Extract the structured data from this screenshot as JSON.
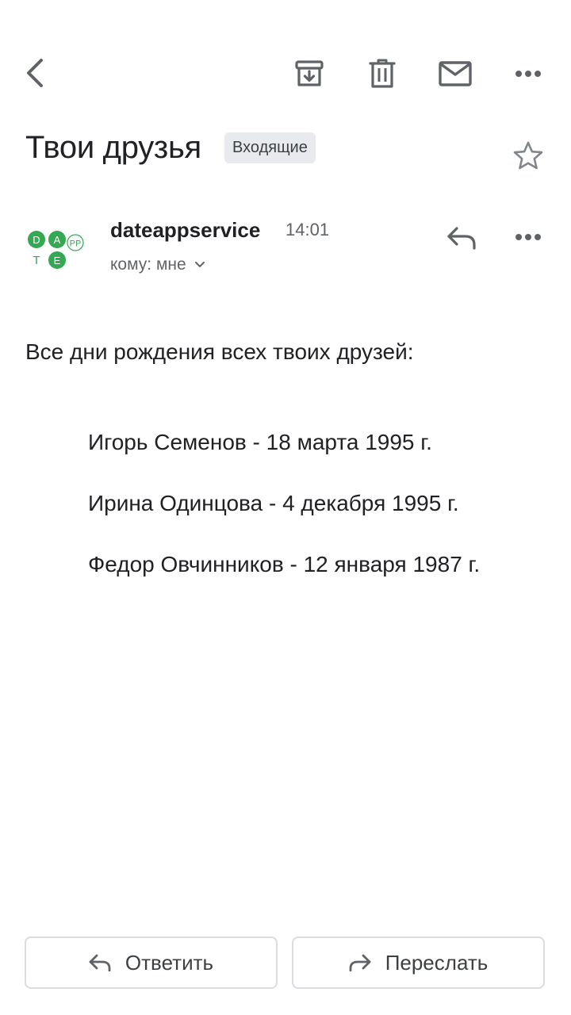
{
  "toolbar": {
    "back_icon": "chevron-left-icon",
    "archive_icon": "archive-icon",
    "delete_icon": "trash-icon",
    "mark_unread_icon": "mail-icon",
    "more_icon": "more-horizontal-icon"
  },
  "email": {
    "subject": "Твои друзья",
    "label": "Входящие",
    "star_icon": "star-outline-icon"
  },
  "sender": {
    "avatar_letters": [
      "D",
      "A",
      "PP",
      "T",
      "E"
    ],
    "name": "dateappservice",
    "time": "14:01",
    "recipient": "кому: мне",
    "reply_icon": "reply-icon",
    "more_icon": "more-horizontal-icon"
  },
  "body": {
    "intro": "Все дни рождения всех твоих друзей:",
    "birthdays": [
      "Игорь Семенов - 18 марта 1995 г.",
      "Ирина Одинцова - 4 декабря 1995 г.",
      "Федор Овчинников - 12 января 1987 г."
    ]
  },
  "actions": {
    "reply_label": "Ответить",
    "forward_label": "Переслать"
  },
  "colors": {
    "icon": "#5f6368",
    "text": "#202124",
    "secondary_text": "#5f6368",
    "chip_bg": "#e8eaed",
    "logo_green": "#34a853",
    "border": "#dadce0"
  }
}
